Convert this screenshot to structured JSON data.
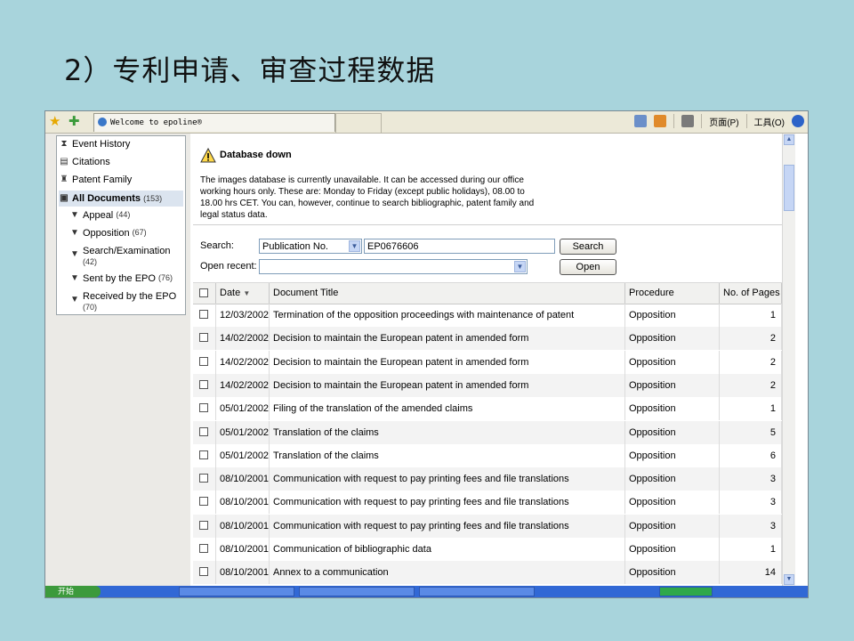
{
  "slide_title": "2）专利申请、审查过程数据",
  "browser": {
    "tab_title": "Welcome to epoline®",
    "page_menu": "页面(P)",
    "tools_menu": "工具(O)"
  },
  "sidebar": {
    "items": [
      {
        "label": "Event History",
        "count": ""
      },
      {
        "label": "Citations",
        "count": ""
      },
      {
        "label": "Patent Family",
        "count": ""
      },
      {
        "label": "All Documents",
        "count": "(153)"
      },
      {
        "label": "Appeal",
        "count": "(44)"
      },
      {
        "label": "Opposition",
        "count": "(67)"
      },
      {
        "label": "Search/Examination",
        "count": "(42)"
      },
      {
        "label": "Sent by the EPO",
        "count": "(76)"
      },
      {
        "label": "Received by the EPO",
        "count": "(70)"
      }
    ]
  },
  "banner": {
    "title": "Database down",
    "text": "The images database is currently unavailable. It can be accessed during our office working hours only. These are: Monday to Friday (except public holidays), 08.00 to 18.00 hrs CET. You can, however, continue to search bibliographic, patent family and legal status data."
  },
  "search": {
    "label": "Search:",
    "type_value": "Publication No.",
    "number_value": "EP0676606",
    "button": "Search",
    "recent_label": "Open recent:",
    "recent_value": "",
    "open_button": "Open"
  },
  "table": {
    "headers": {
      "date": "Date",
      "title": "Document Title",
      "procedure": "Procedure",
      "pages": "No. of Pages"
    },
    "rows": [
      {
        "date": "12/03/2002",
        "title": "Termination of the opposition proceedings with maintenance of patent",
        "procedure": "Opposition",
        "pages": "1"
      },
      {
        "date": "14/02/2002",
        "title": "Decision to maintain the European patent in amended form",
        "procedure": "Opposition",
        "pages": "2"
      },
      {
        "date": "14/02/2002",
        "title": "Decision to maintain the European patent in amended form",
        "procedure": "Opposition",
        "pages": "2"
      },
      {
        "date": "14/02/2002",
        "title": "Decision to maintain the European patent in amended form",
        "procedure": "Opposition",
        "pages": "2"
      },
      {
        "date": "05/01/2002",
        "title": "Filing of the translation of the amended claims",
        "procedure": "Opposition",
        "pages": "1"
      },
      {
        "date": "05/01/2002",
        "title": "Translation of the claims",
        "procedure": "Opposition",
        "pages": "5"
      },
      {
        "date": "05/01/2002",
        "title": "Translation of the claims",
        "procedure": "Opposition",
        "pages": "6"
      },
      {
        "date": "08/10/2001",
        "title": "Communication with request to pay printing fees and file translations",
        "procedure": "Opposition",
        "pages": "3"
      },
      {
        "date": "08/10/2001",
        "title": "Communication with request to pay printing fees and file translations",
        "procedure": "Opposition",
        "pages": "3"
      },
      {
        "date": "08/10/2001",
        "title": "Communication with request to pay printing fees and file translations",
        "procedure": "Opposition",
        "pages": "3"
      },
      {
        "date": "08/10/2001",
        "title": "Communication of bibliographic data",
        "procedure": "Opposition",
        "pages": "1"
      },
      {
        "date": "08/10/2001",
        "title": "Annex to a communication",
        "procedure": "Opposition",
        "pages": "14"
      }
    ]
  },
  "taskbar": {
    "start_label": "开始"
  }
}
